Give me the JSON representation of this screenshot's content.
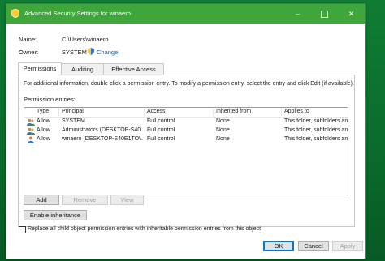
{
  "window": {
    "title": "Advanced Security Settings for winaero",
    "controls": {
      "minimize": "–",
      "maximize": "",
      "close": "✕"
    }
  },
  "header": {
    "name_label": "Name:",
    "name_value": "C:\\Users\\winaero",
    "owner_label": "Owner:",
    "owner_value": "SYSTEM",
    "change_link": "Change"
  },
  "tabs": [
    {
      "label": "Permissions",
      "active": true
    },
    {
      "label": "Auditing",
      "active": false
    },
    {
      "label": "Effective Access",
      "active": false
    }
  ],
  "info_text": "For additional information, double-click a permission entry. To modify a permission entry, select the entry and click Edit (if available).",
  "entries_label": "Permission entries:",
  "columns": [
    "Type",
    "Principal",
    "Access",
    "Inherited from",
    "Applies to"
  ],
  "rows": [
    {
      "type": "Allow",
      "principal": "SYSTEM",
      "access": "Full control",
      "inherited": "None",
      "applies": "This folder, subfolders and files"
    },
    {
      "type": "Allow",
      "principal": "Administrators (DESKTOP-S40...",
      "access": "Full control",
      "inherited": "None",
      "applies": "This folder, subfolders and files"
    },
    {
      "type": "Allow",
      "principal": "winaero (DESKTOP-S40E1TO\\...",
      "access": "Full control",
      "inherited": "None",
      "applies": "This folder, subfolders and files"
    }
  ],
  "buttons": {
    "add": "Add",
    "remove": "Remove",
    "view": "View",
    "enable_inheritance": "Enable inheritance",
    "ok": "OK",
    "cancel": "Cancel",
    "apply": "Apply"
  },
  "replace_checkbox": {
    "label": "Replace all child object permission entries with inheritable permission entries from this object",
    "checked": false
  },
  "colors": {
    "titlebar": "#3ea63b",
    "desktop": "#0b6e2e",
    "link": "#1a5fb4",
    "accent": "#0078d7"
  }
}
